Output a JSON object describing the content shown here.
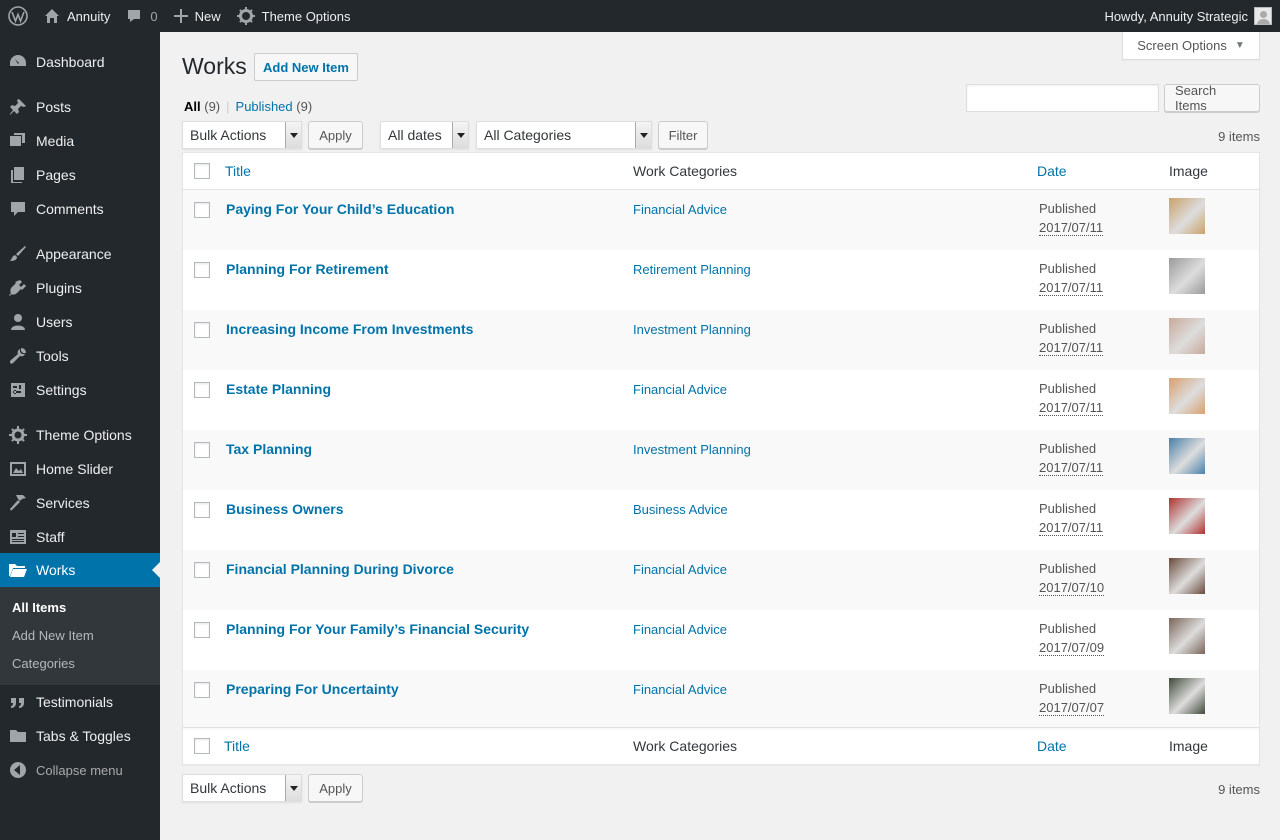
{
  "adminbar": {
    "site_name": "Annuity",
    "comments_count": "0",
    "new_label": "New",
    "theme_options_label": "Theme Options",
    "howdy": "Howdy, Annuity Strategic"
  },
  "sidebar": {
    "items": [
      {
        "label": "Dashboard",
        "icon": "dashboard-icon"
      },
      {
        "label": "Posts",
        "icon": "pin-icon"
      },
      {
        "label": "Media",
        "icon": "media-icon"
      },
      {
        "label": "Pages",
        "icon": "pages-icon"
      },
      {
        "label": "Comments",
        "icon": "comment-icon"
      },
      {
        "label": "Appearance",
        "icon": "brush-icon"
      },
      {
        "label": "Plugins",
        "icon": "plugin-icon"
      },
      {
        "label": "Users",
        "icon": "user-icon"
      },
      {
        "label": "Tools",
        "icon": "wrench-icon"
      },
      {
        "label": "Settings",
        "icon": "settings-icon"
      },
      {
        "label": "Theme Options",
        "icon": "gear-icon"
      },
      {
        "label": "Home Slider",
        "icon": "image-icon"
      },
      {
        "label": "Services",
        "icon": "hammer-icon"
      },
      {
        "label": "Staff",
        "icon": "id-card-icon"
      },
      {
        "label": "Works",
        "icon": "folder-icon"
      },
      {
        "label": "Testimonials",
        "icon": "quote-icon"
      },
      {
        "label": "Tabs & Toggles",
        "icon": "folder-icon"
      },
      {
        "label": "Collapse menu",
        "icon": "collapse-icon"
      }
    ],
    "submenu": [
      "All Items",
      "Add New Item",
      "Categories"
    ]
  },
  "main": {
    "screen_options": "Screen Options",
    "title": "Works",
    "add_new": "Add New Item",
    "views": {
      "all": "All",
      "all_count": "(9)",
      "published": "Published",
      "published_count": "(9)"
    },
    "search_button": "Search Items",
    "bulk_actions": "Bulk Actions",
    "apply": "Apply",
    "all_dates": "All dates",
    "all_categories": "All Categories",
    "filter": "Filter",
    "items_count": "9 items",
    "columns": {
      "title": "Title",
      "categories": "Work Categories",
      "date": "Date",
      "image": "Image"
    },
    "rows": [
      {
        "title": "Paying For Your Child’s Education",
        "category": "Financial Advice",
        "status": "Published",
        "date": "2017/07/11",
        "thumb_color": "#c9a16c"
      },
      {
        "title": "Planning For Retirement",
        "category": "Retirement Planning",
        "status": "Published",
        "date": "2017/07/11",
        "thumb_color": "#9a9a9a"
      },
      {
        "title": "Increasing Income From Investments",
        "category": "Investment Planning",
        "status": "Published",
        "date": "2017/07/11",
        "thumb_color": "#c8a99a"
      },
      {
        "title": "Estate Planning",
        "category": "Financial Advice",
        "status": "Published",
        "date": "2017/07/11",
        "thumb_color": "#d8a070"
      },
      {
        "title": "Tax Planning",
        "category": "Investment Planning",
        "status": "Published",
        "date": "2017/07/11",
        "thumb_color": "#4a7fa8"
      },
      {
        "title": "Business Owners",
        "category": "Business Advice",
        "status": "Published",
        "date": "2017/07/11",
        "thumb_color": "#b03030"
      },
      {
        "title": "Financial Planning During Divorce",
        "category": "Financial Advice",
        "status": "Published",
        "date": "2017/07/10",
        "thumb_color": "#6a4a3a"
      },
      {
        "title": "Planning For Your Family’s Financial Security",
        "category": "Financial Advice",
        "status": "Published",
        "date": "2017/07/09",
        "thumb_color": "#7a6458"
      },
      {
        "title": "Preparing For Uncertainty",
        "category": "Financial Advice",
        "status": "Published",
        "date": "2017/07/07",
        "thumb_color": "#3f4a3a"
      }
    ]
  }
}
